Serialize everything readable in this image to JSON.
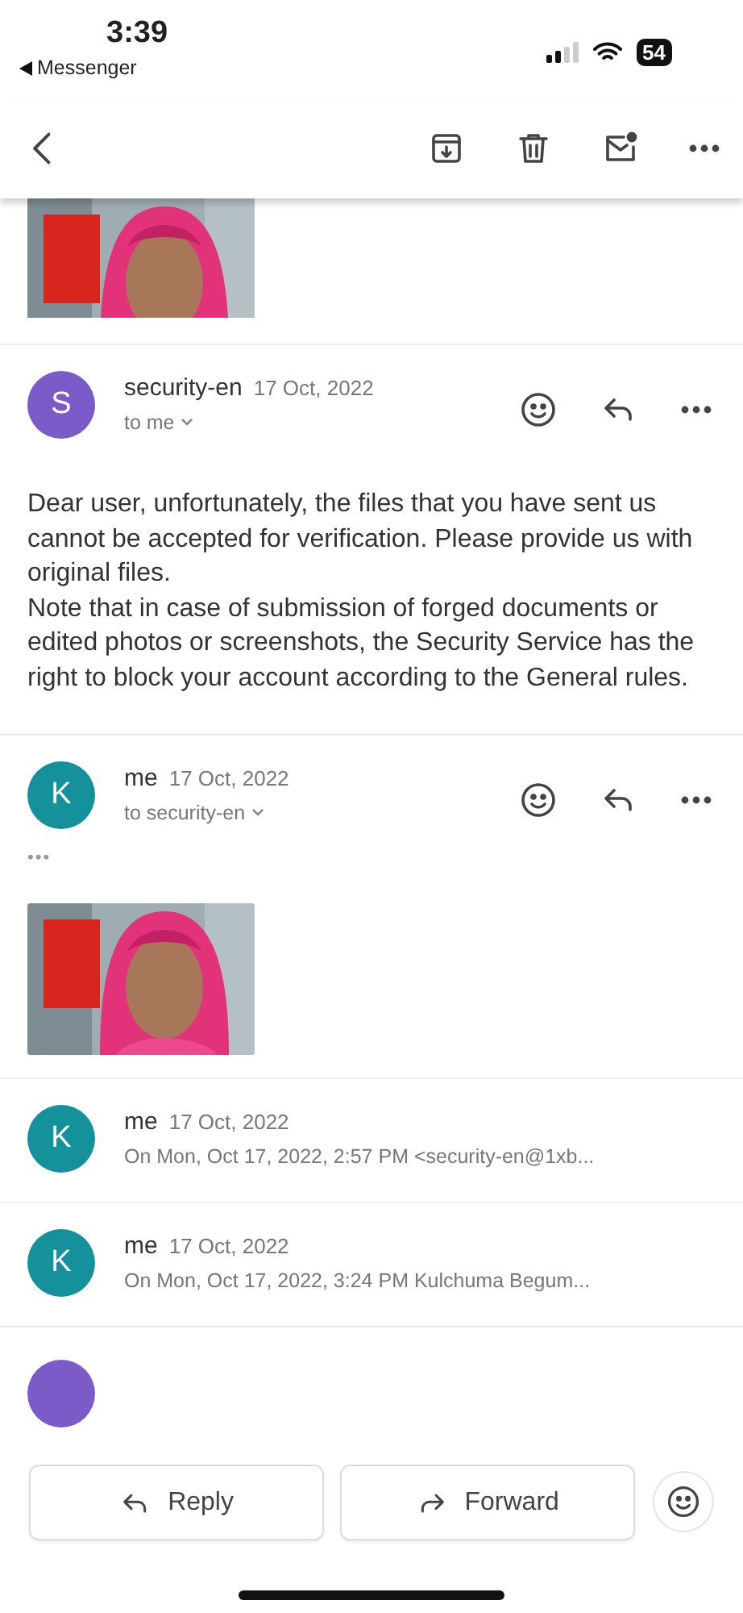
{
  "status_bar": {
    "time": "3:39",
    "back_app": "Messenger",
    "battery": "54"
  },
  "messages": [
    {
      "kind": "expanded",
      "avatar": "S",
      "color": "#7b5bc8",
      "sender": "security-en",
      "date": "17 Oct, 2022",
      "recipient": "to me",
      "body": [
        "Dear user, unfortunately, the files that you have sent us cannot be accepted for verification. Please provide us with original files.",
        "Note that in case of submission of forged documents or edited photos or screenshots, the Security Service has the right to block your account according to the General rules."
      ]
    },
    {
      "kind": "expanded",
      "avatar": "K",
      "color": "#15919b",
      "sender": "me",
      "date": "17 Oct, 2022",
      "recipient": "to security-en",
      "trimmed": "•••"
    },
    {
      "kind": "collapsed",
      "avatar": "K",
      "color": "#15919b",
      "sender": "me",
      "date": "17 Oct, 2022",
      "snippet": "On Mon, Oct 17, 2022, 2:57 PM <security-en@1xb..."
    },
    {
      "kind": "collapsed",
      "avatar": "K",
      "color": "#15919b",
      "sender": "me",
      "date": "17 Oct, 2022",
      "snippet": "On Mon, Oct 17, 2022, 3:24 PM Kulchuma Begum..."
    },
    {
      "kind": "hidden",
      "color": "#7b5bc8"
    }
  ],
  "actions": [
    {
      "kind": "reply",
      "label": "Reply"
    },
    {
      "kind": "forward",
      "label": "Forward"
    }
  ]
}
